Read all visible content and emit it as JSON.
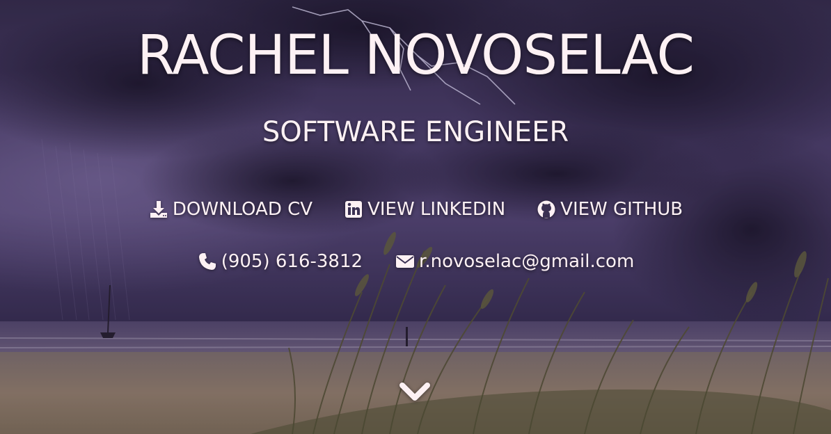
{
  "hero": {
    "name": "RACHEL NOVOSELAC",
    "role": "SOFTWARE ENGINEER"
  },
  "links": {
    "download_cv": {
      "label": "DOWNLOAD CV",
      "icon": "download-icon"
    },
    "linkedin": {
      "label": "VIEW LINKEDIN",
      "icon": "linkedin-icon"
    },
    "github": {
      "label": "VIEW GITHUB",
      "icon": "github-icon"
    }
  },
  "contact": {
    "phone": {
      "label": "(905) 616-3812",
      "icon": "phone-icon"
    },
    "email": {
      "label": "r.novoselac@gmail.com",
      "icon": "envelope-icon"
    }
  },
  "scroll": {
    "icon": "chevron-down-icon"
  },
  "colors": {
    "text": "#fdf1f4",
    "sky_dark": "#231c38",
    "sky_mid": "#5b4b7e",
    "sand": "#a89178"
  }
}
